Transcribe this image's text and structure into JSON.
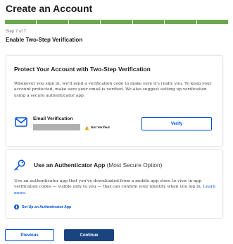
{
  "header": {
    "title": "Create an Account"
  },
  "progress": {
    "total_steps": 7,
    "completed_steps": 7,
    "color": "#6aa84f"
  },
  "step": {
    "counter": "Step 7 of 7",
    "title": "Enable Two-Step Verification"
  },
  "protect_card": {
    "heading": "Protect Your Account with Two-Step Verification",
    "description": "Whenever you sign in, we'll send a verification code to make sure it's really you. To keep your account protected, make sure your email is verified. We also suggest setting up verification using a secure authenticator app.",
    "email": {
      "label": "Email Verification",
      "icon": "envelope-icon",
      "status_icon": "warning-icon",
      "status": "Not Verified",
      "verify_label": "Verify"
    }
  },
  "authenticator_card": {
    "icon": "key-icon",
    "heading": "Use an Authenticator App",
    "heading_note": "(Most Secure Option)",
    "description": "Use an authenticator app that you've downloaded from a mobile app store to view in-app verification codes — visible only to you — that can confirm your identity when you log in.",
    "learn_more": "Learn more.",
    "setup_icon": "plus-circle-icon",
    "setup_link": "Set Up an Authenticator App"
  },
  "footer": {
    "previous_label": "Previous",
    "continue_label": "Continue"
  },
  "colors": {
    "primary": "#0050d8",
    "primary_dark": "#1a4480",
    "warning": "#ffbe2e",
    "success": "#6aa84f"
  }
}
